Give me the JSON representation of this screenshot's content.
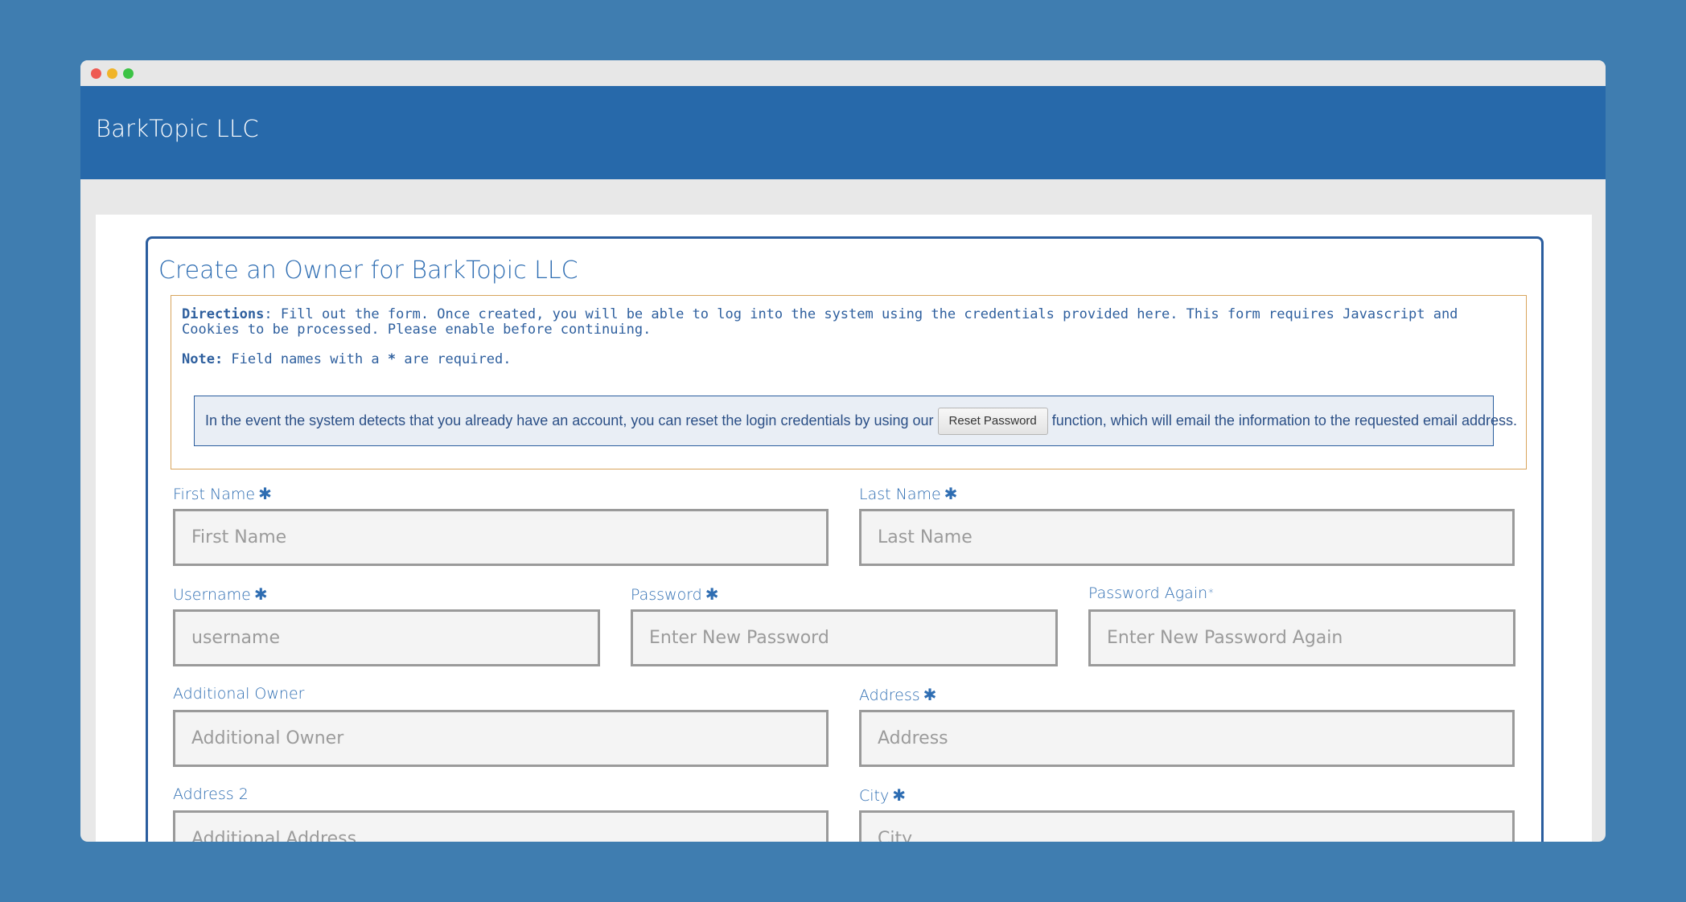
{
  "brand": "BarkTopic LLC",
  "form": {
    "title": "Create an Owner for BarkTopic LLC",
    "directions_label": "Directions",
    "directions_text": ": Fill out the form. Once created, you will be able to log into the system using the credentials provided here. This form requires Javascript and Cookies to be processed. Please enable before continuing.",
    "note_label": "Note:",
    "note_text_before": " Field names with a ",
    "note_asterisk": "*",
    "note_text_after": "  are required.",
    "reset_text_before": "In the event the system detects that you already have an account, you can reset the login credentials by using our",
    "reset_button": "Reset Password",
    "reset_text_after": "function, which will email the information to the requested email address.",
    "required_marker": "✱",
    "required_marker_small": "*",
    "fields": {
      "first_name": {
        "label": "First Name",
        "placeholder": "First Name"
      },
      "last_name": {
        "label": "Last Name",
        "placeholder": "Last Name"
      },
      "username": {
        "label": "Username",
        "placeholder": "username"
      },
      "password": {
        "label": "Password",
        "placeholder": "Enter New Password"
      },
      "password_again": {
        "label": "Password Again",
        "placeholder": "Enter New Password Again"
      },
      "additional_owner": {
        "label": "Additional Owner",
        "placeholder": "Additional Owner"
      },
      "address": {
        "label": "Address",
        "placeholder": "Address"
      },
      "address2": {
        "label": "Address 2",
        "placeholder": "Additional Address"
      },
      "city": {
        "label": "City",
        "placeholder": "City"
      }
    }
  },
  "colors": {
    "background": "#3f7db0",
    "header": "#2769aa",
    "accent_text": "#2e6db2",
    "card_border": "#2a5d9e",
    "directions_border": "#d8a45c"
  }
}
